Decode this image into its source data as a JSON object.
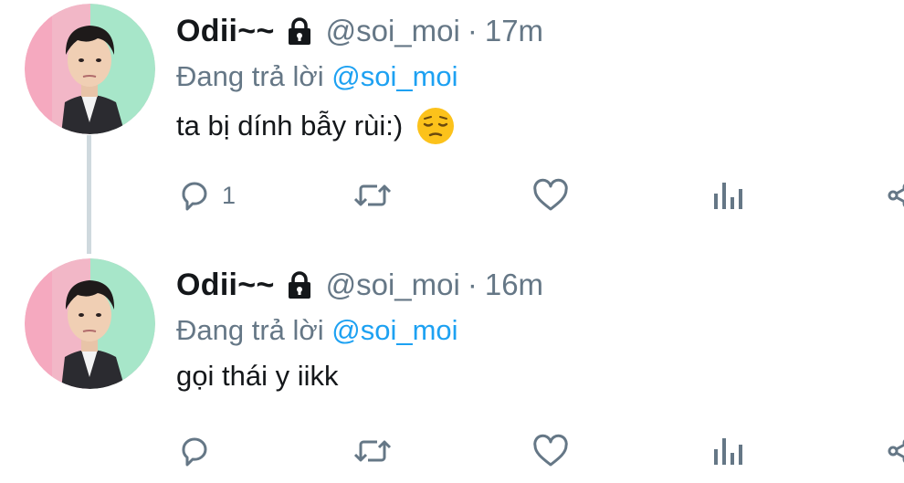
{
  "thread": {
    "tweets": [
      {
        "display_name": "Odii~~",
        "handle": "@soi_moi",
        "separator": "·",
        "time": "17m",
        "reply_prefix": "Đang trả lời",
        "reply_to": "@soi_moi",
        "text": "ta bị dính bẫy rùi:)",
        "emoji": "pensive-face-emoji",
        "reply_count": "1"
      },
      {
        "display_name": "Odii~~",
        "handle": "@soi_moi",
        "separator": "·",
        "time": "16m",
        "reply_prefix": "Đang trả lời",
        "reply_to": "@soi_moi",
        "text": "gọi thái y iikk",
        "reply_count": ""
      }
    ]
  },
  "icons": {
    "reply": "reply-icon",
    "retweet": "retweet-icon",
    "like": "heart-icon",
    "analytics": "analytics-icon",
    "share": "share-icon",
    "lock": "lock-icon"
  },
  "colors": {
    "primary_text": "#14171a",
    "secondary_text": "#657786",
    "link": "#1da1f2",
    "icon": "#657786",
    "thread_line": "#cfd9de"
  }
}
